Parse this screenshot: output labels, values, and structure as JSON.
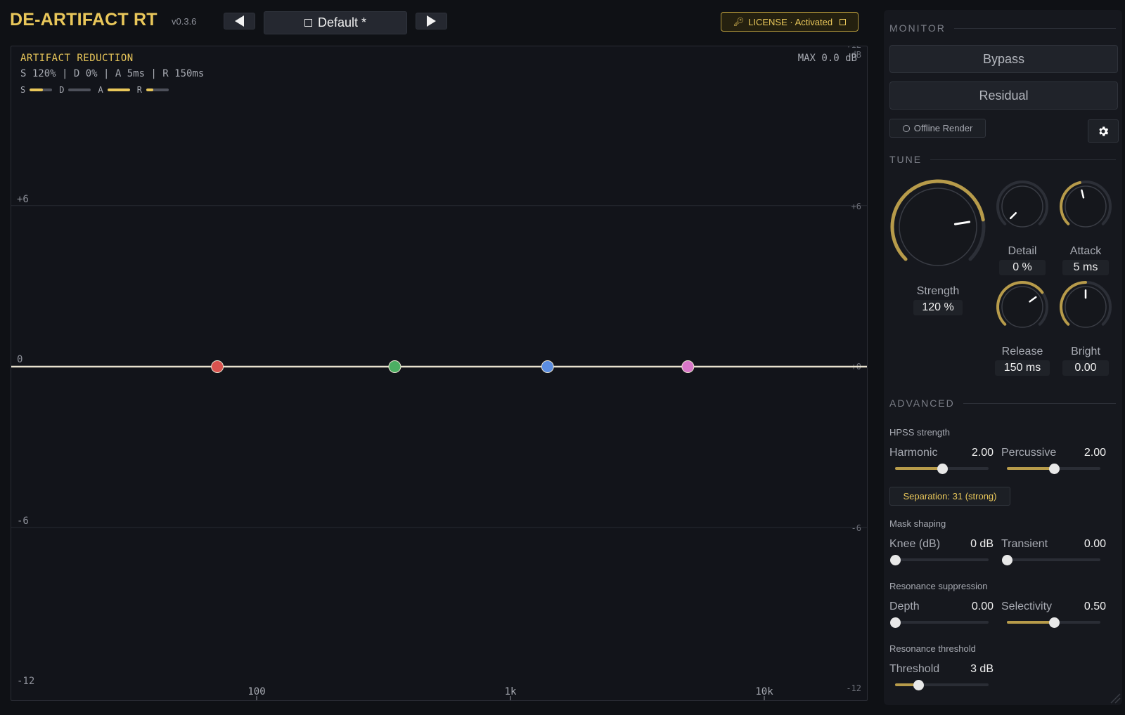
{
  "header": {
    "app_title": "DE-ARTIFACT RT",
    "version": "v0.3.6",
    "preset_name": "Default *",
    "license_label": "LICENSE · Activated"
  },
  "graph": {
    "title": "ARTIFACT REDUCTION",
    "params_text": "S 120% | D 0% | A 5ms | R 150ms",
    "max_readout": "MAX 0.0 dB",
    "mini_meters": [
      {
        "label": "S",
        "level": 0.6
      },
      {
        "label": "D",
        "level": 0.0
      },
      {
        "label": "A",
        "level": 1.0
      },
      {
        "label": "R",
        "level": 0.3
      }
    ],
    "y_labels_left": [
      {
        "text": "+6",
        "db": 6
      },
      {
        "text": "0",
        "db": 0
      },
      {
        "text": "-6",
        "db": -6
      },
      {
        "text": "-12",
        "db": -12
      }
    ],
    "y_labels_right": [
      {
        "text": "+12",
        "db": 12
      },
      {
        "text": "dB",
        "db": 11
      },
      {
        "text": "+6",
        "db": 6
      },
      {
        "text": "+0",
        "db": 0
      },
      {
        "text": "-6",
        "db": -6
      },
      {
        "text": "-12",
        "db": -12
      }
    ],
    "x_labels": [
      {
        "text": "100",
        "hz": 100
      },
      {
        "text": "1k",
        "hz": 1000
      },
      {
        "text": "10k",
        "hz": 10000
      }
    ],
    "band_nodes": [
      {
        "name": "band-1",
        "hz": 70,
        "gain_db": 0,
        "color": "#d9534f"
      },
      {
        "name": "band-2",
        "hz": 350,
        "gain_db": 0,
        "color": "#4caf63"
      },
      {
        "name": "band-3",
        "hz": 1400,
        "gain_db": 0,
        "color": "#5b8de0"
      },
      {
        "name": "band-4",
        "hz": 5000,
        "gain_db": 0,
        "color": "#d877c8"
      }
    ]
  },
  "monitor": {
    "section_title": "MONITOR",
    "bypass_label": "Bypass",
    "residual_label": "Residual",
    "offline_render_label": "Offline Render"
  },
  "tune": {
    "section_title": "TUNE",
    "knobs": {
      "strength": {
        "label": "Strength",
        "value": "120 %",
        "level": 0.8
      },
      "detail": {
        "label": "Detail",
        "value": "0 %",
        "level": 0.0
      },
      "attack": {
        "label": "Attack",
        "value": "5 ms",
        "level": 0.45
      },
      "release": {
        "label": "Release",
        "value": "150 ms",
        "level": 0.7
      },
      "bright": {
        "label": "Bright",
        "value": "0.00",
        "level": 0.5
      }
    }
  },
  "advanced": {
    "section_title": "ADVANCED",
    "hpss_label": "HPSS strength",
    "harmonic": {
      "label": "Harmonic",
      "value": "2.00",
      "level": 0.5
    },
    "percussive": {
      "label": "Percussive",
      "value": "2.00",
      "level": 0.5
    },
    "separation_text": "Separation: 31 (strong)",
    "mask_label": "Mask shaping",
    "knee": {
      "label": "Knee (dB)",
      "value": "0 dB",
      "level": 0.0
    },
    "transient": {
      "label": "Transient",
      "value": "0.00",
      "level": 0.0
    },
    "resonance_label": "Resonance suppression",
    "depth": {
      "label": "Depth",
      "value": "0.00",
      "level": 0.0
    },
    "selectivity": {
      "label": "Selectivity",
      "value": "0.50",
      "level": 0.5
    },
    "threshold_label": "Resonance threshold",
    "threshold": {
      "label": "Threshold",
      "value": "3 dB",
      "level": 0.25
    }
  },
  "colors": {
    "accent": "#e9c75a",
    "background": "#0f1115",
    "panel": "#16181e"
  }
}
